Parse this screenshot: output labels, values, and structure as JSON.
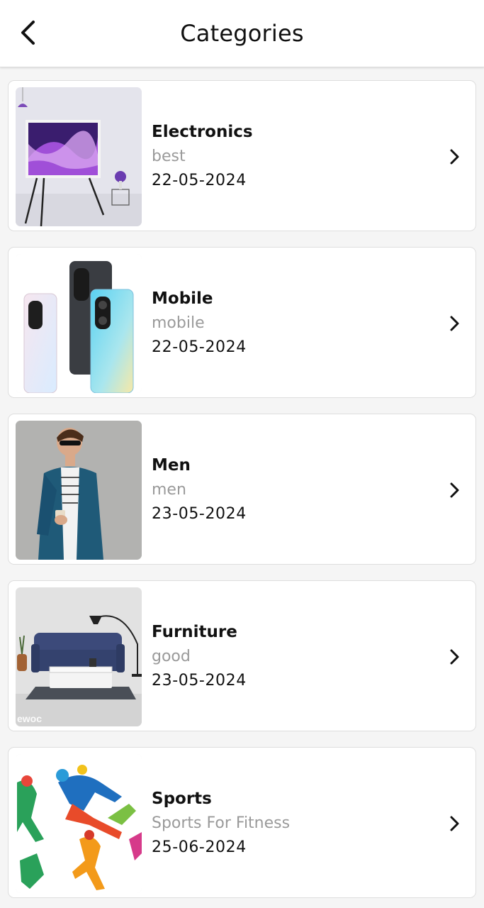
{
  "header": {
    "title": "Categories",
    "back_icon": "back-arrow-icon"
  },
  "categories": [
    {
      "name": "Electronics",
      "subtitle": "best",
      "date": "22-05-2024",
      "image": "tv-on-easel-photo"
    },
    {
      "name": "Mobile",
      "subtitle": "mobile",
      "date": "22-05-2024",
      "image": "smartphones-photo"
    },
    {
      "name": "Men",
      "subtitle": "men",
      "date": "23-05-2024",
      "image": "man-in-blue-blazer-photo"
    },
    {
      "name": "Furniture",
      "subtitle": "good",
      "date": "23-05-2024",
      "image": "sofa-living-room-photo",
      "image_watermark": "ewoc"
    },
    {
      "name": "Sports",
      "subtitle": "Sports For Fitness",
      "date": "25-06-2024",
      "image": "colorful-athletes-illustration"
    }
  ],
  "colors": {
    "background": "#f5f5f5",
    "card": "#ffffff",
    "subtitle": "#9a9a9a",
    "text": "#111111"
  }
}
